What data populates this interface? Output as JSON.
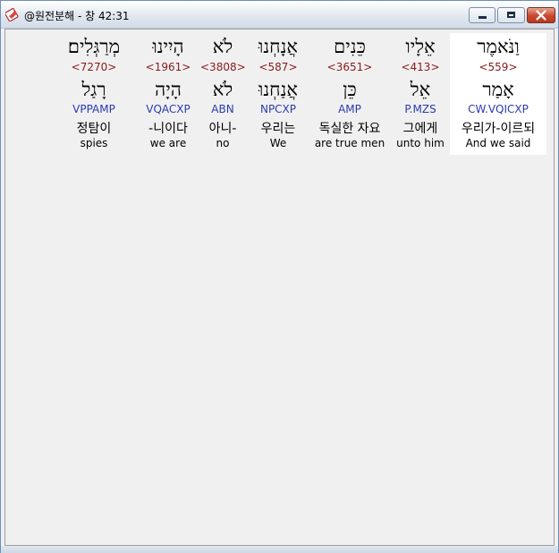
{
  "window": {
    "title": "@원전분해 - 창 42:31"
  },
  "words": [
    {
      "hebrew": "וַנֹּאמֶר",
      "strong": "<559>",
      "lemma": "אָמַר",
      "morph": "CW.VQICXP",
      "korean": "우리가-이르되",
      "english": "And we said",
      "selected": true
    },
    {
      "hebrew": "אֵלָיו",
      "strong": "<413>",
      "lemma": "אֵל",
      "morph": "P.MZS",
      "korean": "그에게",
      "english": "unto him",
      "selected": false
    },
    {
      "hebrew": "כֵּנִים",
      "strong": "<3651>",
      "lemma": "כֵּן",
      "morph": "AMP",
      "korean": "독실한 자요",
      "english": "are true men",
      "selected": false
    },
    {
      "hebrew": "אֲנָחְנוּ",
      "strong": "<587>",
      "lemma": "אֲנַחְנוּ",
      "morph": "NPCXP",
      "korean": "우리는",
      "english": "We",
      "selected": false
    },
    {
      "hebrew": "לֹא",
      "strong": "<3808>",
      "lemma": "לֹא",
      "morph": "ABN",
      "korean": "아니-",
      "english": "no",
      "selected": false
    },
    {
      "hebrew": "הָיִינוּ",
      "strong": "<1961>",
      "lemma": "הָיָה",
      "morph": "VQACXP",
      "korean": "-니이다",
      "english": "we are",
      "selected": false
    },
    {
      "hebrew": "מְרַגְּלִים׃",
      "strong": "<7270>",
      "lemma": "רָגַל",
      "morph": "VPPAMP",
      "korean": "정탐이",
      "english": "spies",
      "selected": false
    }
  ]
}
